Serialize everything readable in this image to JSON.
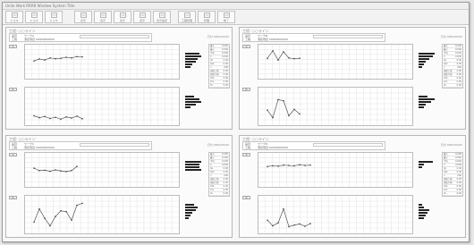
{
  "window": {
    "title": "Unite Work RRRR Window System Title"
  },
  "toolbar": {
    "buttons": [
      {
        "label": "ドコマ",
        "icon": "file-icon"
      },
      {
        "label": "ドコマ",
        "icon": "folder-icon"
      },
      {
        "label": "ドコマ",
        "icon": "save-icon"
      },
      {
        "label": "表示",
        "icon": "view-icon"
      },
      {
        "label": "表示",
        "icon": "grid-icon"
      },
      {
        "label": "表示",
        "icon": "table-icon"
      },
      {
        "label": "表示",
        "icon": "chart-icon"
      },
      {
        "label": "表示設定",
        "icon": "settings-icon"
      },
      {
        "label": "工程管理",
        "icon": "tool-icon"
      },
      {
        "label": "管理",
        "icon": "list-icon"
      },
      {
        "label": "終了",
        "icon": "exit-icon"
      }
    ]
  },
  "panels": [
    {
      "title": "工程: ○○ライン",
      "row1_key": "品目",
      "row1_val": "ワークA",
      "row2_key": "工程",
      "row2_val": "測定項目 00000000000",
      "status": "日付 0000/00/00",
      "chip_top": "X",
      "chip_bottom": "R",
      "stats": [
        {
          "k": "最大",
          "v": "0.000"
        },
        {
          "k": "最小",
          "v": "0.000"
        },
        {
          "k": "平均",
          "v": "0.000"
        },
        {
          "k": "σ",
          "v": "0.000"
        },
        {
          "k": "Cp",
          "v": "0.00"
        },
        {
          "k": "Cpk",
          "v": "0.00"
        },
        {
          "k": "n",
          "v": "000"
        },
        {
          "k": "規格上限",
          "v": "0.00"
        },
        {
          "k": "規格下限",
          "v": "0.00"
        },
        {
          "k": "UCL",
          "v": "0.00"
        },
        {
          "k": "LCL",
          "v": "0.00"
        },
        {
          "k": "CL",
          "v": "0.00"
        }
      ]
    },
    {
      "title": "工程: ○○ライン",
      "row1_key": "品目",
      "row1_val": "ワークB",
      "row2_key": "工程",
      "row2_val": "測定項目 00000000000",
      "status": "日付 0000/00/00",
      "chip_top": "X",
      "chip_bottom": "R",
      "stats": [
        {
          "k": "最大",
          "v": "0.000"
        },
        {
          "k": "最小",
          "v": "0.000"
        },
        {
          "k": "平均",
          "v": "0.000"
        },
        {
          "k": "σ",
          "v": "0.000"
        },
        {
          "k": "Cp",
          "v": "0.00"
        },
        {
          "k": "Cpk",
          "v": "0.00"
        },
        {
          "k": "n",
          "v": "000"
        },
        {
          "k": "規格上限",
          "v": "0.00"
        },
        {
          "k": "規格下限",
          "v": "0.00"
        },
        {
          "k": "UCL",
          "v": "0.00"
        },
        {
          "k": "LCL",
          "v": "0.00"
        },
        {
          "k": "CL",
          "v": "0.00"
        }
      ]
    },
    {
      "title": "工程: ○○ライン",
      "row1_key": "品目",
      "row1_val": "ワークC",
      "row2_key": "工程",
      "row2_val": "測定項目 00000000000",
      "status": "日付 0000/00/00",
      "chip_top": "X",
      "chip_bottom": "R",
      "stats": [
        {
          "k": "最大",
          "v": "0.000"
        },
        {
          "k": "最小",
          "v": "0.000"
        },
        {
          "k": "平均",
          "v": "0.000"
        },
        {
          "k": "σ",
          "v": "0.000"
        },
        {
          "k": "Cp",
          "v": "0.00"
        },
        {
          "k": "Cpk",
          "v": "0.00"
        },
        {
          "k": "n",
          "v": "000"
        },
        {
          "k": "規格上限",
          "v": "0.00"
        },
        {
          "k": "規格下限",
          "v": "0.00"
        },
        {
          "k": "UCL",
          "v": "0.00"
        },
        {
          "k": "LCL",
          "v": "0.00"
        },
        {
          "k": "CL",
          "v": "0.00"
        }
      ]
    },
    {
      "title": "工程: ○○ライン",
      "row1_key": "品目",
      "row1_val": "ワークD",
      "row2_key": "工程",
      "row2_val": "測定項目 00000000000",
      "status": "日付 0000/00/00",
      "chip_top": "X",
      "chip_bottom": "R",
      "stats": [
        {
          "k": "最大",
          "v": "0.000"
        },
        {
          "k": "最小",
          "v": "0.000"
        },
        {
          "k": "平均",
          "v": "0.000"
        },
        {
          "k": "σ",
          "v": "0.000"
        },
        {
          "k": "Cp",
          "v": "0.00"
        },
        {
          "k": "Cpk",
          "v": "0.00"
        },
        {
          "k": "n",
          "v": "000"
        },
        {
          "k": "規格上限",
          "v": "0.00"
        },
        {
          "k": "規格下限",
          "v": "0.00"
        },
        {
          "k": "UCL",
          "v": "0.00"
        },
        {
          "k": "LCL",
          "v": "0.00"
        },
        {
          "k": "CL",
          "v": "0.00"
        }
      ]
    }
  ],
  "chart_data": [
    {
      "type": "line",
      "x": [
        1,
        2,
        3,
        4,
        5,
        6,
        7,
        8,
        9,
        10
      ],
      "series": [
        {
          "values": [
            5.2,
            5.8,
            5.5,
            6.1,
            5.9,
            6.0,
            6.3,
            6.1,
            6.5,
            6.4
          ]
        }
      ],
      "ylim": [
        0,
        10
      ],
      "histogram": [
        8,
        9,
        7,
        6,
        4,
        3
      ]
    },
    {
      "type": "line",
      "x": [
        1,
        2,
        3,
        4,
        5,
        6,
        7,
        8,
        9,
        10
      ],
      "series": [
        {
          "values": [
            2.5,
            2.0,
            2.3,
            1.8,
            2.1,
            1.6,
            2.2,
            1.9,
            2.4,
            1.7
          ]
        }
      ],
      "ylim": [
        0,
        10
      ],
      "histogram": [
        5,
        8,
        9,
        6,
        3
      ]
    },
    {
      "type": "line",
      "x": [
        1,
        2,
        3,
        4,
        5,
        6,
        7
      ],
      "series": [
        {
          "values": [
            6.0,
            8.2,
            5.5,
            7.9,
            6.1,
            5.9,
            6.0
          ]
        }
      ],
      "ylim": [
        0,
        10
      ],
      "histogram": [
        9,
        8,
        6,
        4,
        3,
        2
      ]
    },
    {
      "type": "line",
      "x": [
        1,
        2,
        3,
        4,
        5,
        6,
        7
      ],
      "series": [
        {
          "values": [
            4.0,
            2.0,
            6.8,
            6.5,
            2.5,
            4.2,
            3.0
          ]
        }
      ],
      "ylim": [
        0,
        10
      ],
      "histogram": [
        5,
        9,
        7,
        4,
        3
      ]
    },
    {
      "type": "line",
      "x": [
        1,
        2,
        3,
        4,
        5,
        6,
        7,
        8,
        9
      ],
      "series": [
        {
          "values": [
            5.5,
            4.8,
            4.9,
            4.6,
            5.0,
            4.7,
            4.5,
            4.8,
            6.0
          ]
        }
      ],
      "ylim": [
        0,
        10
      ],
      "histogram": [
        9,
        8,
        8,
        9
      ]
    },
    {
      "type": "line",
      "x": [
        1,
        2,
        3,
        4,
        5,
        6,
        7,
        8,
        9,
        10
      ],
      "series": [
        {
          "values": [
            3.0,
            6.5,
            4.0,
            2.0,
            4.5,
            6.0,
            5.8,
            3.5,
            7.5,
            8.0
          ]
        }
      ],
      "ylim": [
        0,
        10
      ],
      "histogram": [
        5,
        7,
        6,
        4,
        3,
        2
      ]
    },
    {
      "type": "line",
      "x": [
        1,
        2,
        3,
        4,
        5,
        6,
        7,
        8,
        9
      ],
      "series": [
        {
          "values": [
            6.0,
            6.2,
            6.1,
            6.4,
            6.3,
            6.2,
            6.5,
            6.3,
            6.4
          ]
        }
      ],
      "ylim": [
        0,
        10
      ],
      "histogram": [
        8,
        3,
        2
      ]
    },
    {
      "type": "line",
      "x": [
        1,
        2,
        3,
        4,
        5,
        6,
        7,
        8,
        9
      ],
      "series": [
        {
          "values": [
            3.5,
            2.0,
            2.8,
            6.5,
            1.8,
            2.2,
            2.5,
            1.9,
            2.6
          ]
        }
      ],
      "ylim": [
        0,
        10
      ],
      "histogram": [
        2,
        3,
        6,
        5,
        4,
        3
      ]
    }
  ]
}
